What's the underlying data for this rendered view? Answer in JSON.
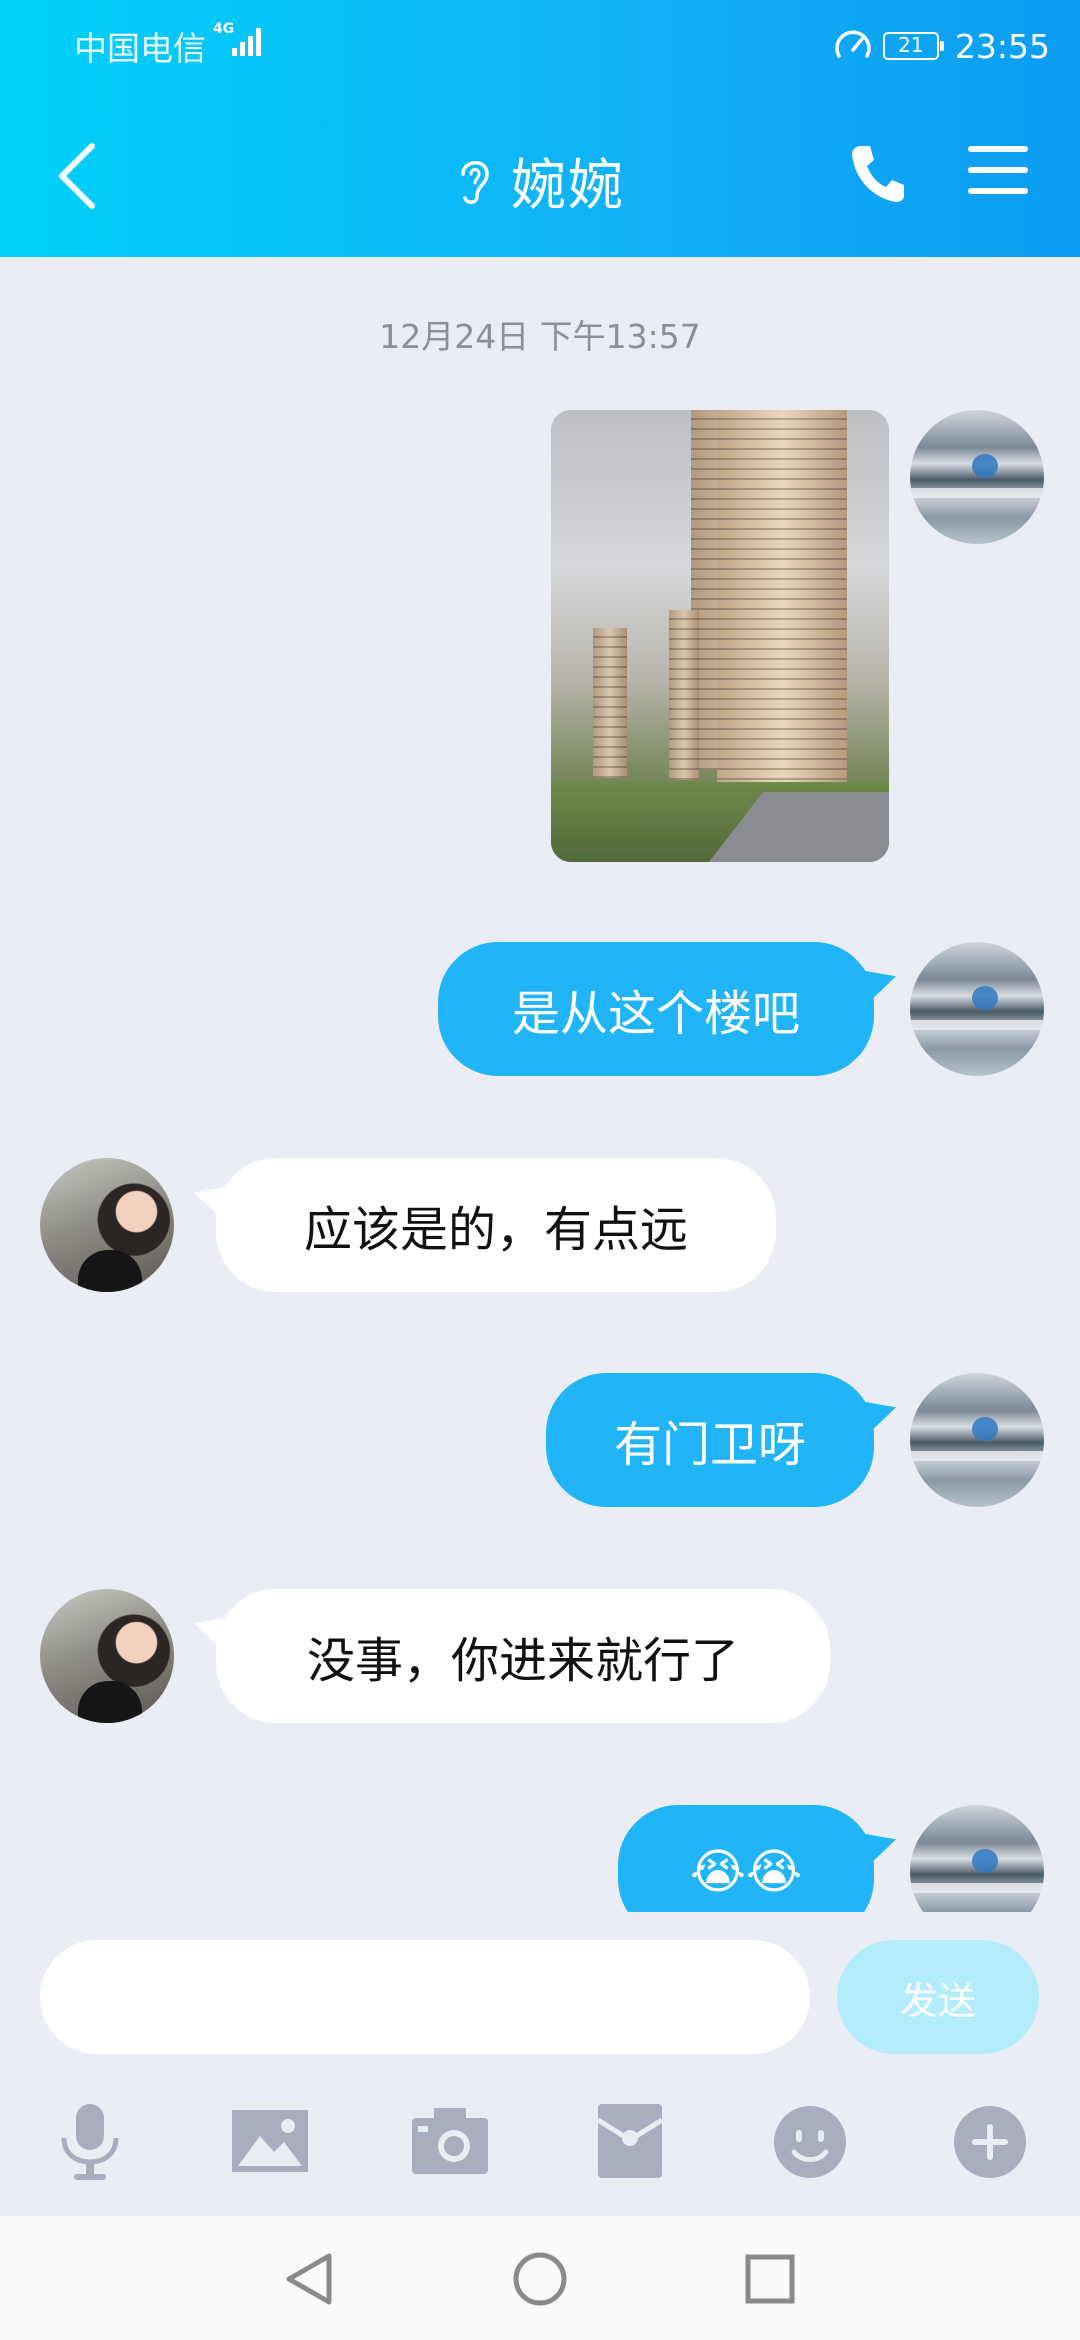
{
  "status_bar": {
    "carrier": "中国电信",
    "network": "4G",
    "battery": "21",
    "time": "23:55"
  },
  "header": {
    "contact_name": "婉婉"
  },
  "chat": {
    "timestamp": "12月24日 下午13:57",
    "messages": [
      {
        "from": "me",
        "type": "image"
      },
      {
        "from": "me",
        "type": "text",
        "text": "是从这个楼吧"
      },
      {
        "from": "her",
        "type": "text",
        "text": "应该是的，有点远"
      },
      {
        "from": "me",
        "type": "text",
        "text": "有门卫呀"
      },
      {
        "from": "her",
        "type": "text",
        "text": "没事，你进来就行了"
      },
      {
        "from": "me",
        "type": "text",
        "text": "😭😭"
      }
    ]
  },
  "input": {
    "placeholder": "",
    "send_label": "发送"
  },
  "toolbar": {
    "items": [
      "mic-icon",
      "image-icon",
      "camera-icon",
      "red-packet-icon",
      "emoji-icon",
      "plus-icon"
    ]
  },
  "colors": {
    "header_start": "#00d1fc",
    "header_end": "#0c9cf2",
    "bubble_out": "#21b5f8",
    "send_button": "#b3edfb",
    "background": "#eaedf4"
  }
}
